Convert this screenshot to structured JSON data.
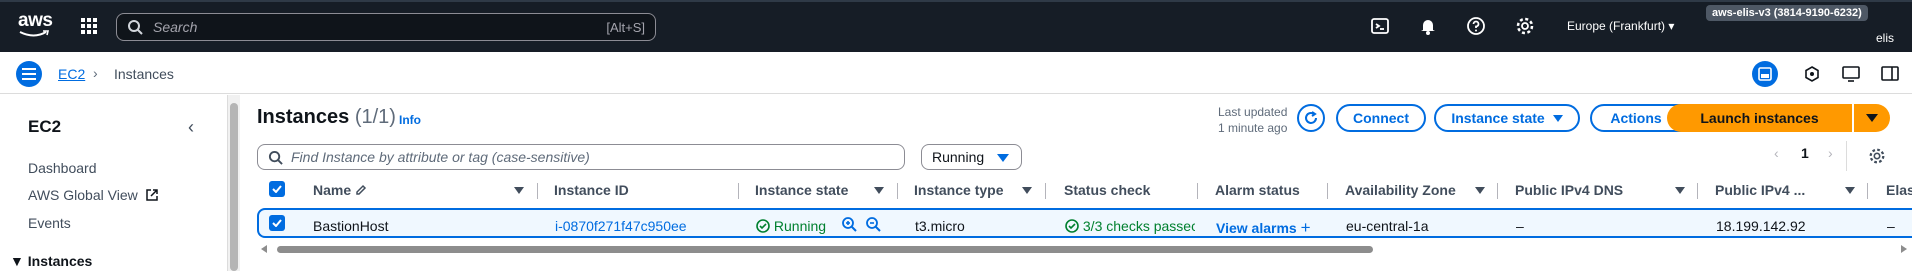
{
  "topnav": {
    "logo_text": "aws",
    "search_placeholder": "Search",
    "search_shortcut": "[Alt+S]",
    "region": "Europe (Frankfurt)",
    "account": "aws-elis-v3 (3814-9190-6232)",
    "username": "elis"
  },
  "breadcrumb": {
    "root": "EC2",
    "current": "Instances"
  },
  "sidebar": {
    "title": "EC2",
    "items": [
      "Dashboard",
      "AWS Global View",
      "Events"
    ],
    "section": "Instances"
  },
  "main": {
    "title": "Instances",
    "count": "(1/1)",
    "info": "Info",
    "last_updated_line1": "Last updated",
    "last_updated_line2": "1 minute ago",
    "connect": "Connect",
    "instance_state": "Instance state",
    "actions": "Actions",
    "launch": "Launch instances",
    "find_placeholder": "Find Instance by attribute or tag (case-sensitive)",
    "filter_value": "Running",
    "page": "1"
  },
  "table": {
    "columns": [
      "Name",
      "Instance ID",
      "Instance state",
      "Instance type",
      "Status check",
      "Alarm status",
      "Availability Zone",
      "Public IPv4 DNS",
      "Public IPv4 ...",
      "Elas"
    ],
    "row": {
      "name": "BastionHost",
      "instance_id": "i-0870f271f47c950ee",
      "state": "Running",
      "type": "t3.micro",
      "status": "3/3 checks passec",
      "alarm": "View alarms",
      "az": "eu-central-1a",
      "dns": "–",
      "ipv4": "18.199.142.92",
      "elastic": "–"
    }
  },
  "colors": {
    "accent": "#006ce0",
    "primary": "#ff9900",
    "nav_bg": "#161d26",
    "success": "#00802f"
  }
}
